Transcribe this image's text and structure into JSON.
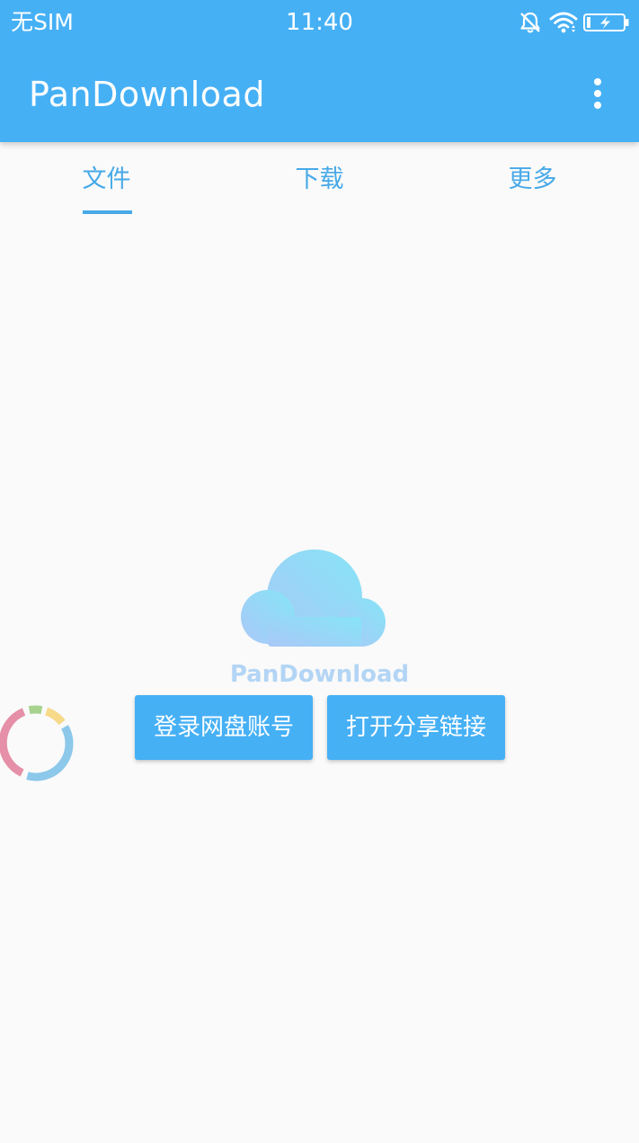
{
  "status_bar": {
    "carrier": "无SIM",
    "time": "11:40",
    "icons": [
      "alarm-off-icon",
      "wifi-icon",
      "battery-charging-icon"
    ]
  },
  "app_bar": {
    "title": "PanDownload",
    "overflow_icon": "more-vert-icon"
  },
  "tabs": [
    {
      "label": "文件",
      "active": true
    },
    {
      "label": "下载",
      "active": false
    },
    {
      "label": "更多",
      "active": false
    }
  ],
  "empty_state": {
    "icon": "cloud-icon",
    "label": "PanDownload"
  },
  "actions": {
    "login_label": "登录网盘账号",
    "open_share_label": "打开分享链接"
  },
  "colors": {
    "primary": "#46b0f5",
    "tab_text": "#47a9e8",
    "background": "#fafafa",
    "cloud_label": "#b3d5f5"
  }
}
